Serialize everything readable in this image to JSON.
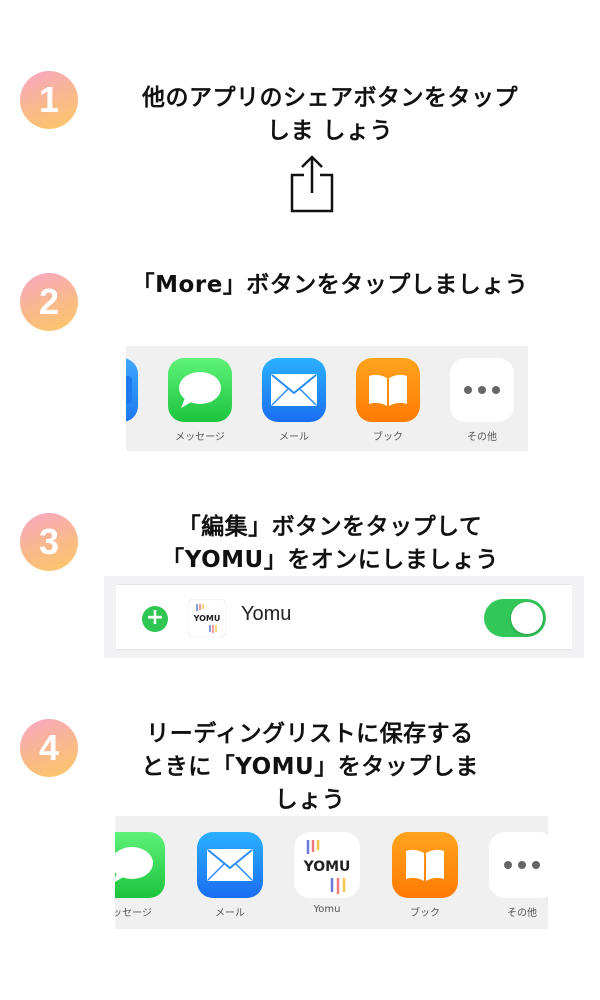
{
  "steps": [
    {
      "number": "1",
      "line1": "他のアプリのシェアボタンをタップ",
      "line2": "しま しょう"
    },
    {
      "number": "2",
      "line1": "「More」ボタンをタップしましょう"
    },
    {
      "number": "3",
      "line1": "「編集」ボタンをタップして",
      "line2": "「YOMU」をオンにしましょう"
    },
    {
      "number": "4",
      "line1": "リーディングリストに保存する",
      "line2": "ときに「YOMU」をタップしま",
      "line3": "しょう"
    }
  ],
  "tray1": {
    "apps": [
      {
        "label": "メッセージ",
        "icon": "messages-icon"
      },
      {
        "label": "メール",
        "icon": "mail-icon"
      },
      {
        "label": "ブック",
        "icon": "books-icon"
      },
      {
        "label": "その他",
        "icon": "more-icon"
      }
    ]
  },
  "edit_row": {
    "label": "Yomu",
    "toggle_on": true
  },
  "tray2": {
    "apps": [
      {
        "label": "ッセージ",
        "icon": "messages-icon"
      },
      {
        "label": "メール",
        "icon": "mail-icon"
      },
      {
        "label": "Yomu",
        "icon": "yomu-icon"
      },
      {
        "label": "ブック",
        "icon": "books-icon"
      },
      {
        "label": "その他",
        "icon": "more-icon"
      }
    ]
  },
  "yomu_logo_text": "YOMU",
  "colors": {
    "badge_start": "#f7a6c4",
    "badge_end": "#fcc866",
    "toggle": "#33c759"
  }
}
